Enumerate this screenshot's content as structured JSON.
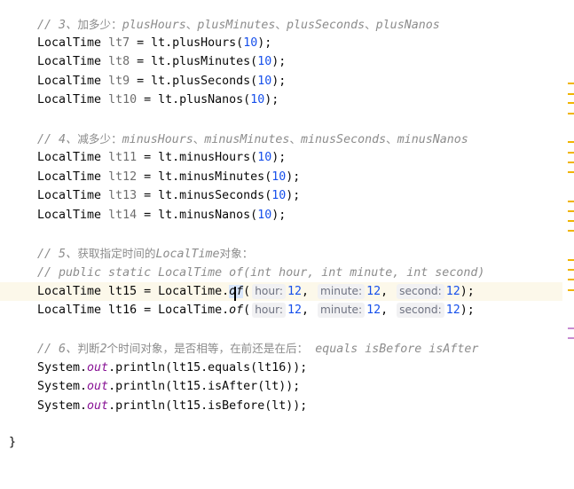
{
  "editor": {
    "section3_comment": "// 3、加多少：plusHours、plusMinutes、plusSeconds、plusNanos",
    "line_lt7": "LocalTime lt7 = lt.plusHours(10);",
    "line_lt8": "LocalTime lt8 = lt.plusMinutes(10);",
    "line_lt9": "LocalTime lt9 = lt.plusSeconds(10);",
    "line_lt10": "LocalTime lt10 = lt.plusNanos(10);",
    "section4_comment": "// 4、减多少：minusHours、minusMinutes、minusSeconds、minusNanos",
    "line_lt11": "LocalTime lt11 = lt.minusHours(10);",
    "line_lt12": "LocalTime lt12 = lt.minusMinutes(10);",
    "line_lt13": "LocalTime lt13 = lt.minusSeconds(10);",
    "line_lt14": "LocalTime lt14 = lt.minusNanos(10);",
    "section5_comment": "// 5、获取指定时间的LocalTime对象：",
    "signature_comment": "// public static LocalTime of(int hour, int minute, int second)",
    "line_lt15": "LocalTime lt15 = LocalTime.of( hour: 12, minute: 12, second: 12);",
    "line_lt16": "LocalTime lt16 = LocalTime.of( hour: 12, minute: 12, second: 12);",
    "section6_comment": "// 6、判断2个时间对象，是否相等，在前还是在后： equals isBefore isAfter",
    "line_print_equals": "System.out.println(lt15.equals(lt16));",
    "line_print_after": "System.out.println(lt15.isAfter(lt));",
    "line_print_before": "System.out.println(lt15.isBefore(lt));",
    "closing_brace": "}"
  },
  "inlay_hints": {
    "hour": "hour:",
    "minute": "minute:",
    "second": "second:"
  },
  "colors": {
    "current_line": "#fcf8ea",
    "comment": "#8c8c8c",
    "number": "#1750eb",
    "static_field": "#871094",
    "warning_stripe": "#f0b400",
    "info_stripe": "#c78bd1"
  }
}
